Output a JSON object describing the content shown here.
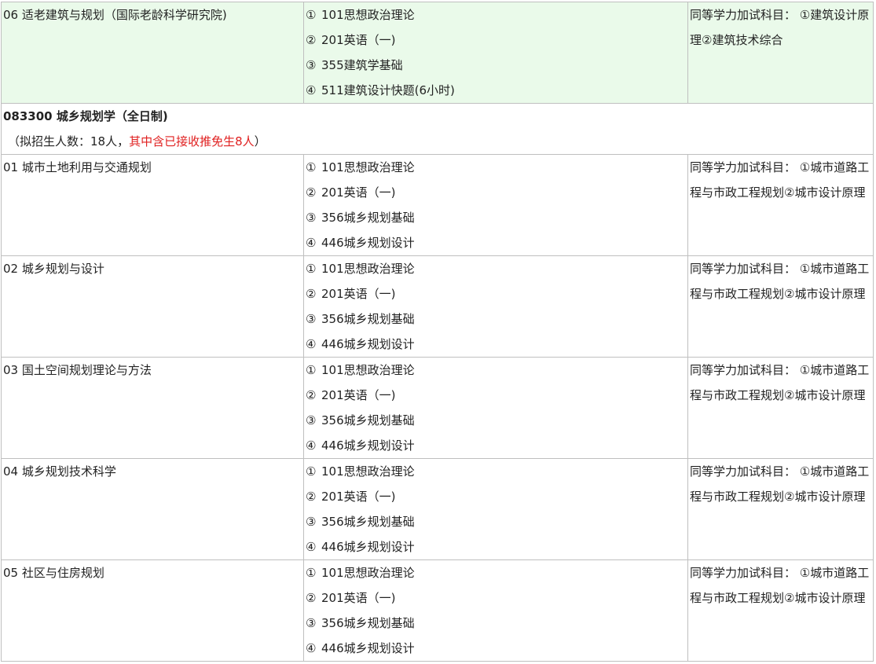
{
  "top_row": {
    "direction": "06 适老建筑与规划（国际老龄科学研究院)",
    "subjects": [
      {
        "mark": "①",
        "text": "101思想政治理论"
      },
      {
        "mark": "②",
        "text": "201英语（一)"
      },
      {
        "mark": "③",
        "text": "355建筑学基础"
      },
      {
        "mark": "④",
        "text": "511建筑设计快题(6小时)"
      }
    ],
    "extra": "同等学力加试科目： ①建筑设计原理②建筑技术综合",
    "bg_color": "#eafaea"
  },
  "major": {
    "title": "083300 城乡规划学（全日制)",
    "quota_prefix": "（拟招生人数：18人，",
    "quota_highlight": "其中含已接收推免生8人",
    "quota_suffix": "）",
    "highlight_color": "#e02020"
  },
  "rows": [
    {
      "direction": "01 城市土地利用与交通规划",
      "subjects": [
        {
          "mark": "①",
          "text": "101思想政治理论"
        },
        {
          "mark": "②",
          "text": "201英语（一)"
        },
        {
          "mark": "③",
          "text": "356城乡规划基础"
        },
        {
          "mark": "④",
          "text": "446城乡规划设计"
        }
      ],
      "extra": "同等学力加试科目： ①城市道路工程与市政工程规划②城市设计原理"
    },
    {
      "direction": "02 城乡规划与设计",
      "subjects": [
        {
          "mark": "①",
          "text": "101思想政治理论"
        },
        {
          "mark": "②",
          "text": "201英语（一)"
        },
        {
          "mark": "③",
          "text": "356城乡规划基础"
        },
        {
          "mark": "④",
          "text": "446城乡规划设计"
        }
      ],
      "extra": "同等学力加试科目： ①城市道路工程与市政工程规划②城市设计原理"
    },
    {
      "direction": "03 国土空间规划理论与方法",
      "subjects": [
        {
          "mark": "①",
          "text": "101思想政治理论"
        },
        {
          "mark": "②",
          "text": "201英语（一)"
        },
        {
          "mark": "③",
          "text": "356城乡规划基础"
        },
        {
          "mark": "④",
          "text": "446城乡规划设计"
        }
      ],
      "extra": "同等学力加试科目： ①城市道路工程与市政工程规划②城市设计原理"
    },
    {
      "direction": "04 城乡规划技术科学",
      "subjects": [
        {
          "mark": "①",
          "text": "101思想政治理论"
        },
        {
          "mark": "②",
          "text": "201英语（一)"
        },
        {
          "mark": "③",
          "text": "356城乡规划基础"
        },
        {
          "mark": "④",
          "text": "446城乡规划设计"
        }
      ],
      "extra": "同等学力加试科目： ①城市道路工程与市政工程规划②城市设计原理"
    },
    {
      "direction": "05 社区与住房规划",
      "subjects": [
        {
          "mark": "①",
          "text": "101思想政治理论"
        },
        {
          "mark": "②",
          "text": "201英语（一)"
        },
        {
          "mark": "③",
          "text": "356城乡规划基础"
        },
        {
          "mark": "④",
          "text": "446城乡规划设计"
        }
      ],
      "extra": "同等学力加试科目： ①城市道路工程与市政工程规划②城市设计原理"
    }
  ]
}
